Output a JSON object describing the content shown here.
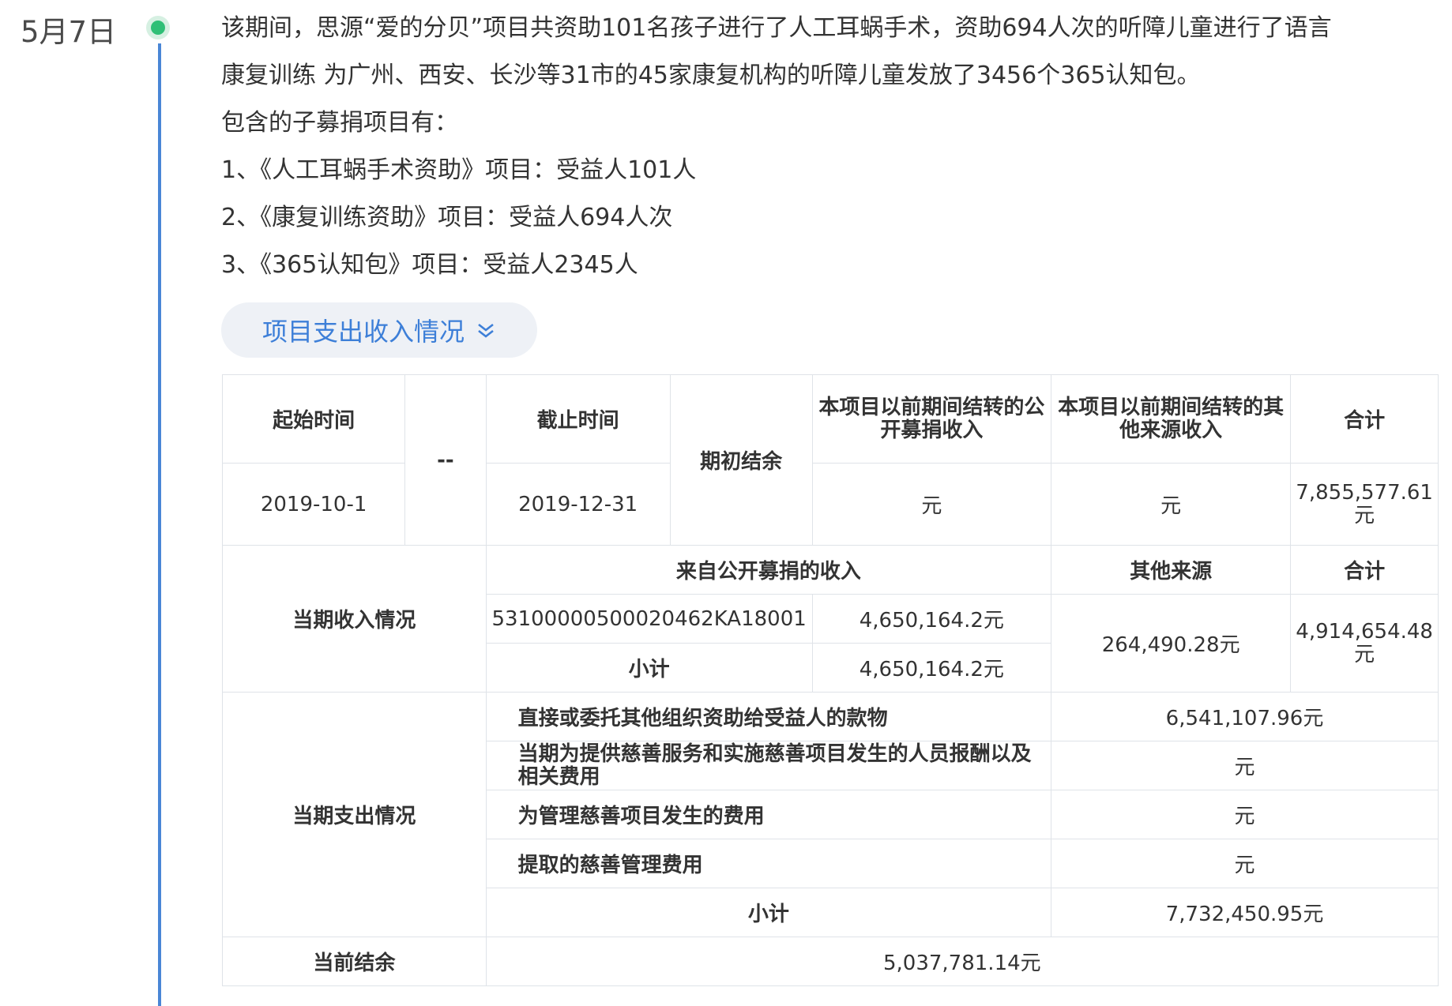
{
  "timeline": {
    "date": "5月7日",
    "paragraph_line1": "该期间，思源“爱的分贝”项目共资助101名孩子进行了人工耳蜗手术，资助694人次的听障儿童进行了语言",
    "paragraph_line2": "康复训练 为广州、西安、长沙等31市的45家康复机构的听障儿童发放了3456个365认知包。",
    "sub_header": "包含的子募捐项目有：",
    "items": [
      "1、《人工耳蜗手术资助》项目：受益人101人",
      "2、《康复训练资助》项目：受益人694人次",
      "3、《365认知包》项目：受益人2345人"
    ],
    "toggle_label": "项目支出收入情况"
  },
  "table": {
    "start_label": "起始时间",
    "dash": "--",
    "end_label": "截止时间",
    "opening_label": "期初结余",
    "prev_public_label": "本项目以前期间结转的公开募捐收入",
    "prev_other_label": "本项目以前期间结转的其他来源收入",
    "total_label": "合计",
    "start_value": "2019-10-1",
    "end_value": "2019-12-31",
    "prev_public_value": "元",
    "prev_other_value": "元",
    "opening_total": "7,855,577.61元",
    "income_label": "当期收入情况",
    "public_income_label": "来自公开募捐的收入",
    "other_source_label": "其他来源",
    "income_total_label": "合计",
    "permit_no": "53100000500020462KA18001",
    "permit_amount": "4,650,164.2元",
    "subtotal_label": "小计",
    "public_subtotal": "4,650,164.2元",
    "other_source_value": "264,490.28元",
    "income_total_value": "4,914,654.48元",
    "expense_label": "当期支出情况",
    "expenses": [
      {
        "label": "直接或委托其他组织资助给受益人的款物",
        "value": "6,541,107.96元"
      },
      {
        "label": "当期为提供慈善服务和实施慈善项目发生的人员报酬以及相关费用",
        "value": "元"
      },
      {
        "label": "为管理慈善项目发生的费用",
        "value": "元"
      },
      {
        "label": "提取的慈善管理费用",
        "value": "元"
      }
    ],
    "expense_subtotal_label": "小计",
    "expense_subtotal": "7,732,450.95元",
    "balance_label": "当前结余",
    "balance_value": "5,037,781.14元"
  },
  "colors": {
    "timeline_line": "#4a86d6",
    "timeline_dot": "#2fbf76",
    "link_blue": "#3d7fd8",
    "border": "#dfe3e8"
  }
}
